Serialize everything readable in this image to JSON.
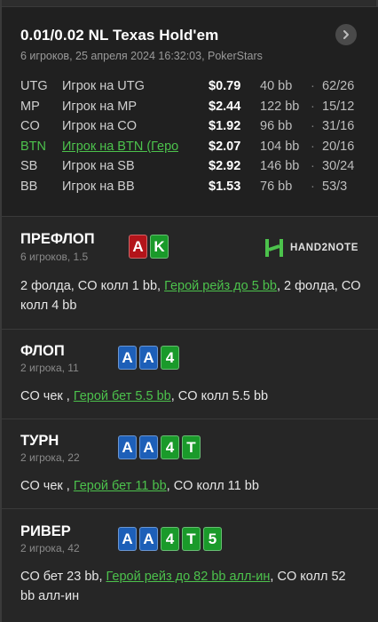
{
  "header": {
    "title": "0.01/0.02 NL Texas Hold'em",
    "subtitle": "6 игроков, 25 апреля 2024 16:32:03, PokerStars",
    "next_icon": "chevron-right-icon"
  },
  "players": [
    {
      "pos": "UTG",
      "name": "Игрок на UTG",
      "stack": "$0.79",
      "bb": "40 bb",
      "stat": "62/26",
      "hero": false
    },
    {
      "pos": "MP",
      "name": "Игрок на MP",
      "stack": "$2.44",
      "bb": "122 bb",
      "stat": "15/12",
      "hero": false
    },
    {
      "pos": "CO",
      "name": "Игрок на CO",
      "stack": "$1.92",
      "bb": "96 bb",
      "stat": "31/16",
      "hero": false
    },
    {
      "pos": "BTN",
      "name": "Игрок на BTN (Геро",
      "stack": "$2.07",
      "bb": "104 bb",
      "stat": "20/16",
      "hero": true
    },
    {
      "pos": "SB",
      "name": "Игрок на SB",
      "stack": "$2.92",
      "bb": "146 bb",
      "stat": "30/24",
      "hero": false
    },
    {
      "pos": "BB",
      "name": "Игрок на BB",
      "stack": "$1.53",
      "bb": "76 bb",
      "stat": "53/3",
      "hero": false
    }
  ],
  "logo": {
    "text": "HAND2NOTE",
    "colors": {
      "accent": "#4cc24c"
    }
  },
  "streets": {
    "preflop": {
      "title": "ПРЕФЛОП",
      "sub": "6 игроков, 1.5",
      "cards": [
        {
          "rank": "A",
          "color": "red"
        },
        {
          "rank": "K",
          "color": "green"
        }
      ],
      "actions": {
        "a1": "2 фолда, CO колл 1 bb, ",
        "hero": "Герой рейз до 5 bb",
        "a2": ", 2 фолда, CO колл 4 bb"
      }
    },
    "flop": {
      "title": "ФЛОП",
      "sub": "2 игрока, 11",
      "cards": [
        {
          "rank": "A",
          "color": "blue"
        },
        {
          "rank": "A",
          "color": "blue"
        },
        {
          "rank": "4",
          "color": "green"
        }
      ],
      "actions": {
        "a1": "CO чек , ",
        "hero": "Герой бет 5.5 bb",
        "a2": ", CO колл 5.5 bb"
      }
    },
    "turn": {
      "title": "ТУРН",
      "sub": "2 игрока, 22",
      "cards": [
        {
          "rank": "A",
          "color": "blue"
        },
        {
          "rank": "A",
          "color": "blue"
        },
        {
          "rank": "4",
          "color": "green"
        },
        {
          "rank": "T",
          "color": "green"
        }
      ],
      "actions": {
        "a1": "CO чек , ",
        "hero": "Герой бет 11 bb",
        "a2": ", CO колл 11 bb"
      }
    },
    "river": {
      "title": "РИВЕР",
      "sub": "2 игрока, 42",
      "cards": [
        {
          "rank": "A",
          "color": "blue"
        },
        {
          "rank": "A",
          "color": "blue"
        },
        {
          "rank": "4",
          "color": "green"
        },
        {
          "rank": "T",
          "color": "green"
        },
        {
          "rank": "5",
          "color": "green"
        }
      ],
      "actions": {
        "a1": "CO бет 23 bb, ",
        "hero": "Герой рейз до 82 bb алл-ин",
        "a2": ", CO колл 52 bb алл-ин"
      }
    }
  }
}
